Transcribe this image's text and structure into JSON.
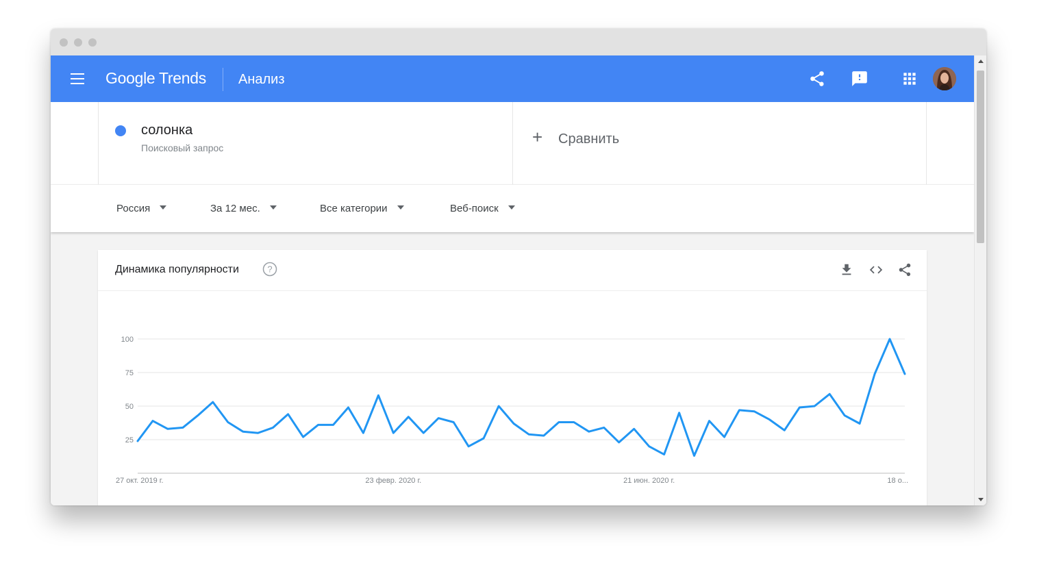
{
  "header": {
    "logo_text": "Google Trends",
    "section_title": "Анализ",
    "icons": [
      "menu-icon",
      "share-icon",
      "feedback-icon",
      "apps-icon",
      "avatar"
    ]
  },
  "term": {
    "name": "солонка",
    "type": "Поисковый запрос",
    "color": "#4285f4"
  },
  "compare": {
    "plus": "+",
    "label": "Сравнить"
  },
  "filters": [
    {
      "label": "Россия"
    },
    {
      "label": "За 12 мес."
    },
    {
      "label": "Все категории"
    },
    {
      "label": "Веб-поиск"
    }
  ],
  "card": {
    "title": "Динамика популярности",
    "help_symbol": "?",
    "actions": [
      "download-icon",
      "embed-icon",
      "share-icon"
    ]
  },
  "colors": {
    "brand": "#4285f4",
    "series": "#2196f3"
  },
  "chart_data": {
    "type": "line",
    "ylim": [
      0,
      100
    ],
    "yticks": [
      25,
      50,
      75,
      100
    ],
    "x_tick_labels": [
      "27 окт. 2019 г.",
      "23 февр. 2020 г.",
      "21 июн. 2020 г.",
      "18 о..."
    ],
    "x_tick_indices": [
      0,
      17,
      34,
      51
    ],
    "grid": true,
    "series": [
      {
        "values": [
          24,
          39,
          33,
          34,
          43,
          53,
          38,
          31,
          30,
          34,
          44,
          27,
          36,
          36,
          49,
          30,
          58,
          30,
          42,
          30,
          41,
          38,
          20,
          26,
          50,
          37,
          29,
          28,
          38,
          38,
          31,
          34,
          23,
          33,
          20,
          14,
          45,
          13,
          39,
          27,
          47,
          46,
          40,
          32,
          49,
          50,
          59,
          43,
          37,
          74,
          100,
          74
        ]
      }
    ]
  }
}
